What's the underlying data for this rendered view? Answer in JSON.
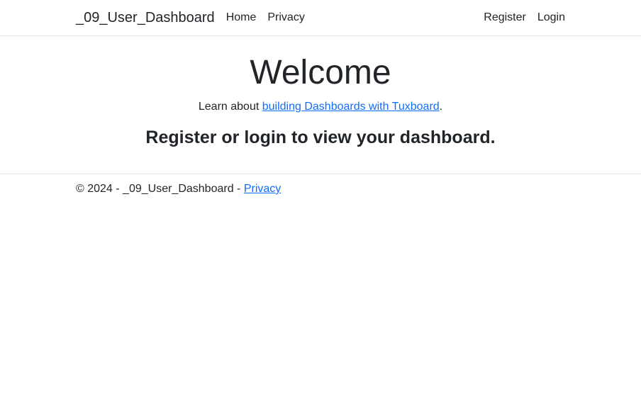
{
  "navbar": {
    "brand": "_09_User_Dashboard",
    "left_links": [
      {
        "label": "Home"
      },
      {
        "label": "Privacy"
      }
    ],
    "right_links": [
      {
        "label": "Register"
      },
      {
        "label": "Login"
      }
    ]
  },
  "main": {
    "title": "Welcome",
    "learn_prefix": "Learn about ",
    "learn_link": "building Dashboards with Tuxboard",
    "learn_suffix": ".",
    "heading": "Register or login to view your dashboard."
  },
  "footer": {
    "copyright": "© 2024 - _09_User_Dashboard - ",
    "privacy_link": "Privacy"
  }
}
